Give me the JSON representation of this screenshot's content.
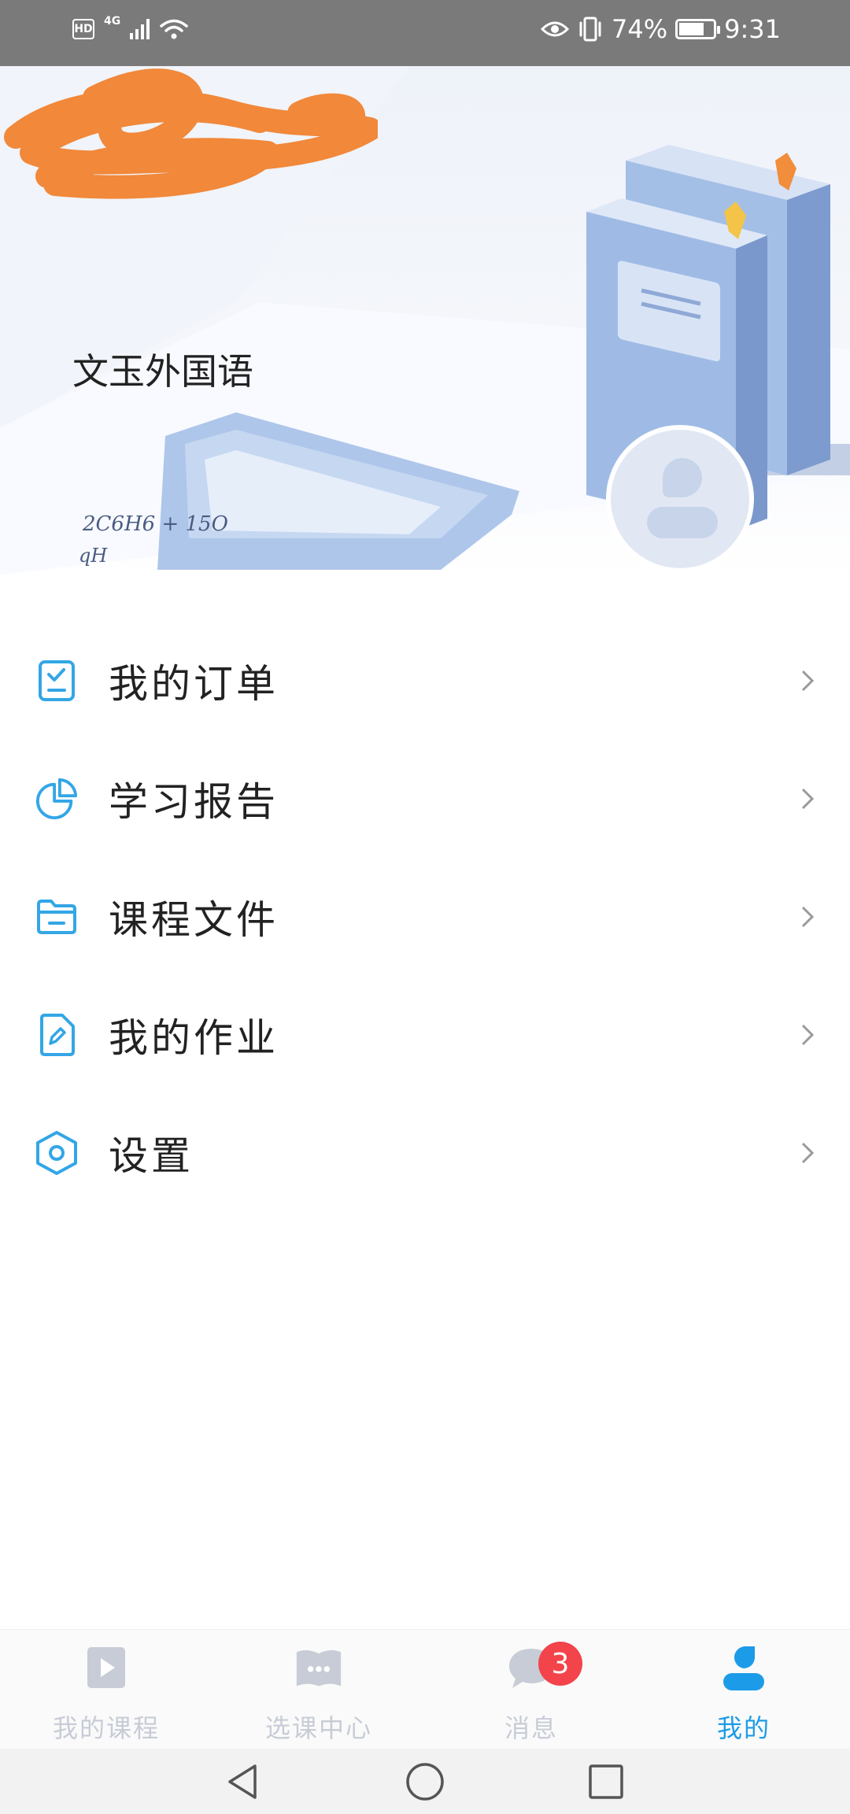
{
  "status_bar": {
    "hd": "HD",
    "network": "4G",
    "battery_percent": "74%",
    "time": "9:31",
    "battery_level": 0.74,
    "icons": [
      "hd-icon",
      "signal-icon",
      "wifi-icon",
      "eye-icon",
      "vibrate-icon",
      "battery-icon"
    ]
  },
  "profile": {
    "school": "文玉外国语",
    "avatar_icon": "user-avatar-icon"
  },
  "menu": [
    {
      "label": "我的订单",
      "icon": "order-clipboard-icon"
    },
    {
      "label": "学习报告",
      "icon": "pie-chart-icon"
    },
    {
      "label": "课程文件",
      "icon": "folder-icon"
    },
    {
      "label": "我的作业",
      "icon": "homework-pencil-icon"
    },
    {
      "label": "设置",
      "icon": "settings-hexagon-icon"
    }
  ],
  "tabbar": {
    "tabs": [
      {
        "label": "我的课程",
        "icon": "play-course-icon",
        "active": false
      },
      {
        "label": "选课中心",
        "icon": "book-dots-icon",
        "active": false
      },
      {
        "label": "消息",
        "icon": "message-bubble-icon",
        "active": false,
        "badge": "3"
      },
      {
        "label": "我的",
        "icon": "user-icon",
        "active": true
      }
    ]
  },
  "navbar": {
    "icons": [
      "back-triangle-icon",
      "home-circle-icon",
      "recents-square-icon"
    ]
  },
  "colors": {
    "accent": "#1c9be8",
    "icon_blue": "#33a6e6",
    "tab_inactive": "#c7ccd6",
    "badge": "#f2444a",
    "status_bar": "#7a7a7a"
  }
}
